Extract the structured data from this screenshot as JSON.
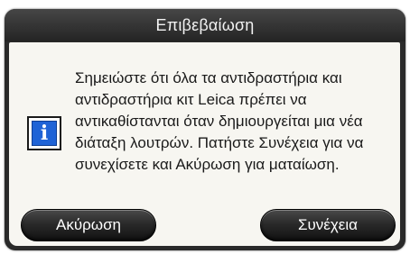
{
  "dialog": {
    "title": "Επιβεβαίωση",
    "icon": "info-icon",
    "message": "Σημειώστε ότι όλα τα αντιδραστήρια και αντιδραστήρια κιτ Leica πρέπει να αντικαθίστανται όταν δημιουργείται μια νέα διάταξη λουτρών. Πατήστε Συνέχεια για να συνεχίσετε και Ακύρωση για ματαίωση.",
    "cancel_label": "Ακύρωση",
    "continue_label": "Συνέχεια"
  },
  "colors": {
    "titlebar": "#2a2a2a",
    "body_background": "#f7f6f1",
    "icon_blue": "#1f63d6",
    "button": "#1e1e1e"
  }
}
